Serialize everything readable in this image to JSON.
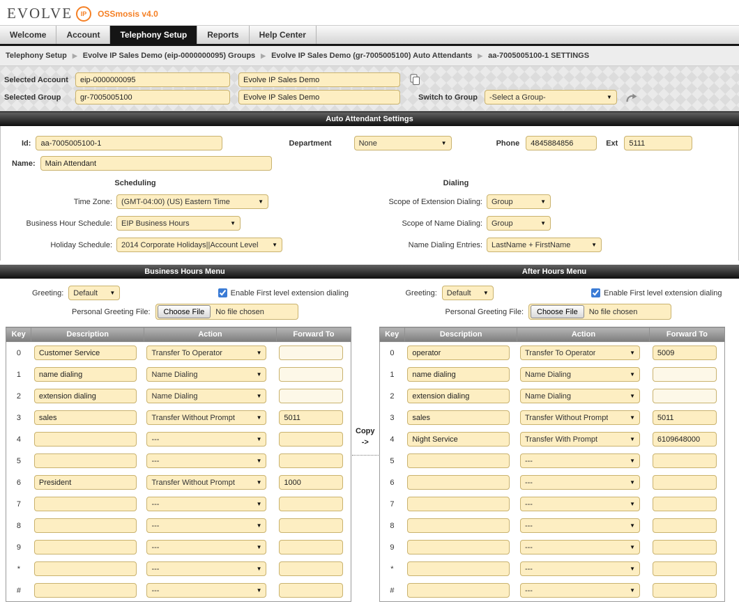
{
  "header": {
    "logo_text": "EVOLVE",
    "logo_ip": "IP",
    "version": "OSSmosis v4.0",
    "brand_orange": "#f58025"
  },
  "nav": {
    "tabs": [
      {
        "label": "Welcome"
      },
      {
        "label": "Account"
      },
      {
        "label": "Telephony Setup"
      },
      {
        "label": "Reports"
      },
      {
        "label": "Help Center"
      }
    ],
    "active_tab": "Telephony Setup"
  },
  "breadcrumb": {
    "items": [
      "Telephony Setup",
      "Evolve IP Sales Demo (eip-0000000095) Groups",
      "Evolve IP Sales Demo (gr-7005005100) Auto Attendants",
      "aa-7005005100-1 SETTINGS"
    ]
  },
  "context": {
    "account_label": "Selected Account",
    "account_id": "eip-0000000095",
    "account_name": "Evolve IP Sales Demo",
    "group_label": "Selected Group",
    "group_id": "gr-7005005100",
    "group_name": "Evolve IP Sales Demo",
    "switch_label": "Switch to Group",
    "switch_value": "-Select a Group-"
  },
  "settings": {
    "title": "Auto Attendant Settings",
    "id_label": "Id:",
    "id_value": "aa-7005005100-1",
    "department_label": "Department",
    "department_value": "None",
    "phone_label": "Phone",
    "phone_value": "4845884856",
    "ext_label": "Ext",
    "ext_value": "5111",
    "name_label": "Name:",
    "name_value": "Main Attendant",
    "scheduling": {
      "title": "Scheduling",
      "fields": [
        {
          "label": "Time Zone:",
          "value": "(GMT-04:00) (US) Eastern Time"
        },
        {
          "label": "Business Hour Schedule:",
          "value": "EIP Business Hours"
        },
        {
          "label": "Holiday Schedule:",
          "value": "2014 Corporate Holidays||Account Level"
        }
      ]
    },
    "dialing": {
      "title": "Dialing",
      "fields": [
        {
          "label": "Scope of Extension Dialing:",
          "value": "Group"
        },
        {
          "label": "Scope of Name Dialing:",
          "value": "Group"
        },
        {
          "label": "Name Dialing Entries:",
          "value": "LastName + FirstName"
        }
      ]
    }
  },
  "menus": {
    "copy_label": "Copy",
    "copy_arrow": "->",
    "columns": [
      "Key",
      "Description",
      "Action",
      "Forward To"
    ],
    "business_hours": {
      "title": "Business Hours Menu",
      "greeting_label": "Greeting:",
      "greeting_value": "Default",
      "enable_label": "Enable First level extension dialing",
      "enable_checked": true,
      "file_label": "Personal Greeting File:",
      "choose_file": "Choose File",
      "no_file": "No file chosen",
      "rows": [
        {
          "key": "0",
          "description": "Customer Service",
          "action": "Transfer To Operator",
          "forward_to": "",
          "forward_muted": true
        },
        {
          "key": "1",
          "description": "name dialing",
          "action": "Name Dialing",
          "forward_to": "",
          "forward_muted": true
        },
        {
          "key": "2",
          "description": "extension dialing",
          "action": "Name Dialing",
          "forward_to": "",
          "forward_muted": true
        },
        {
          "key": "3",
          "description": "sales",
          "action": "Transfer Without Prompt",
          "forward_to": "5011"
        },
        {
          "key": "4",
          "description": "",
          "action": "---",
          "forward_to": ""
        },
        {
          "key": "5",
          "description": "",
          "action": "---",
          "forward_to": ""
        },
        {
          "key": "6",
          "description": "President",
          "action": "Transfer Without Prompt",
          "forward_to": "1000"
        },
        {
          "key": "7",
          "description": "",
          "action": "---",
          "forward_to": ""
        },
        {
          "key": "8",
          "description": "",
          "action": "---",
          "forward_to": ""
        },
        {
          "key": "9",
          "description": "",
          "action": "---",
          "forward_to": ""
        },
        {
          "key": "*",
          "description": "",
          "action": "---",
          "forward_to": ""
        },
        {
          "key": "#",
          "description": "",
          "action": "---",
          "forward_to": ""
        }
      ]
    },
    "after_hours": {
      "title": "After Hours Menu",
      "greeting_label": "Greeting:",
      "greeting_value": "Default",
      "enable_label": "Enable First level extension dialing",
      "enable_checked": true,
      "file_label": "Personal Greeting File:",
      "choose_file": "Choose File",
      "no_file": "No file chosen",
      "rows": [
        {
          "key": "0",
          "description": "operator",
          "action": "Transfer To Operator",
          "forward_to": "5009"
        },
        {
          "key": "1",
          "description": "name dialing",
          "action": "Name Dialing",
          "forward_to": "",
          "forward_muted": true
        },
        {
          "key": "2",
          "description": "extension dialing",
          "action": "Name Dialing",
          "forward_to": "",
          "forward_muted": true
        },
        {
          "key": "3",
          "description": "sales",
          "action": "Transfer Without Prompt",
          "forward_to": "5011"
        },
        {
          "key": "4",
          "description": "Night Service",
          "action": "Transfer With Prompt",
          "forward_to": "6109648000"
        },
        {
          "key": "5",
          "description": "",
          "action": "---",
          "forward_to": ""
        },
        {
          "key": "6",
          "description": "",
          "action": "---",
          "forward_to": ""
        },
        {
          "key": "7",
          "description": "",
          "action": "---",
          "forward_to": ""
        },
        {
          "key": "8",
          "description": "",
          "action": "---",
          "forward_to": ""
        },
        {
          "key": "9",
          "description": "",
          "action": "---",
          "forward_to": ""
        },
        {
          "key": "*",
          "description": "",
          "action": "---",
          "forward_to": ""
        },
        {
          "key": "#",
          "description": "",
          "action": "---",
          "forward_to": ""
        }
      ]
    }
  }
}
